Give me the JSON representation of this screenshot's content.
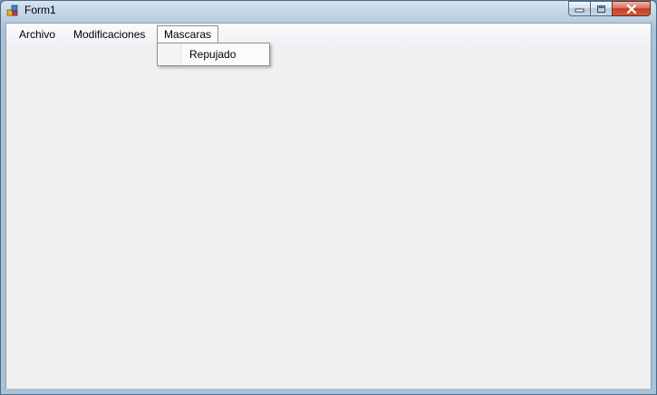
{
  "window": {
    "title": "Form1",
    "controls": {
      "minimize": "minimize-icon",
      "maximize": "maximize-icon",
      "close": "close-icon"
    }
  },
  "menubar": {
    "items": [
      {
        "label": "Archivo"
      },
      {
        "label": "Modificaciones"
      },
      {
        "label": "Mascaras"
      }
    ],
    "active_index": 2
  },
  "dropdown": {
    "items": [
      {
        "label": "Repujado"
      }
    ]
  },
  "colors": {
    "client_background": "#f0f0f0",
    "close_button": "#c24226"
  }
}
